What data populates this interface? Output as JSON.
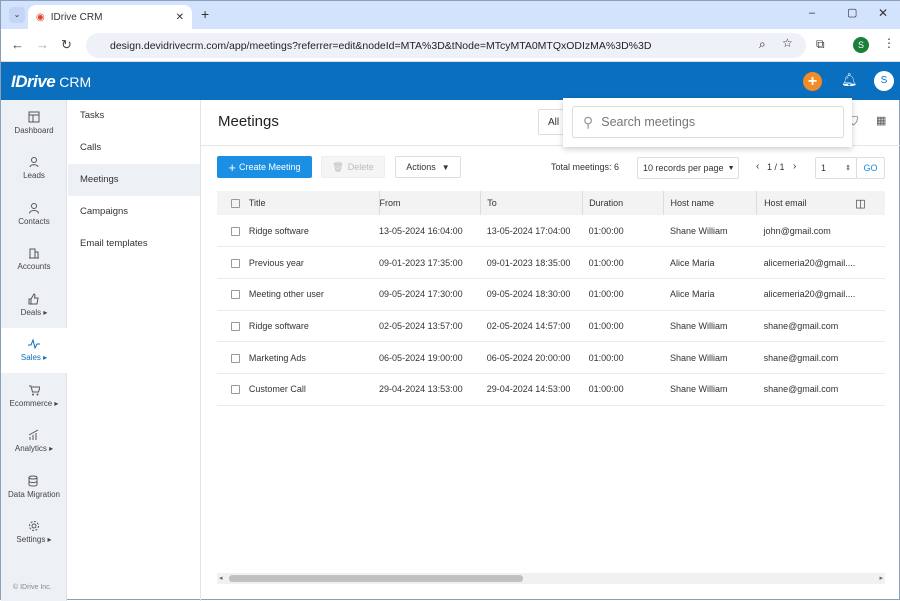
{
  "browser": {
    "tab_title": "IDrive CRM",
    "url": "design.devidrivecrm.com/app/meetings?referrer=edit&nodeId=MTA%3D&tNode=MTcyMTA0MTQxODIzMA%3D%3D",
    "profile_initial": "S"
  },
  "app": {
    "logo": "IDrive",
    "logo_suffix": "CRM",
    "user_initial": "S",
    "accent": "#0a6fbe",
    "add_color": "#f28c28"
  },
  "rail": {
    "items": [
      {
        "label": "Dashboard"
      },
      {
        "label": "Leads"
      },
      {
        "label": "Contacts"
      },
      {
        "label": "Accounts"
      },
      {
        "label": "Deals ▸"
      },
      {
        "label": "Sales ▸"
      },
      {
        "label": "Ecommerce ▸"
      },
      {
        "label": "Analytics ▸"
      },
      {
        "label": "Data Migration"
      },
      {
        "label": "Settings ▸"
      }
    ],
    "copyright": "© IDrive Inc."
  },
  "submenu": {
    "items": [
      "Tasks",
      "Calls",
      "Meetings",
      "Campaigns",
      "Email templates"
    ]
  },
  "main": {
    "title": "Meetings",
    "filter_select": "All",
    "search_placeholder": "Search meetings",
    "create_label": "Create Meeting",
    "delete_label": "Delete",
    "actions_label": "Actions",
    "total_label": "Total meetings: 6",
    "per_page": "10 records per page",
    "page_info": "1 / 1",
    "page_input": "1",
    "go_label": "GO"
  },
  "table": {
    "columns": [
      "Title",
      "From",
      "To",
      "Duration",
      "Host name",
      "Host email"
    ],
    "rows": [
      [
        "Ridge software",
        "13-05-2024 16:04:00",
        "13-05-2024 17:04:00",
        "01:00:00",
        "Shane William",
        "john@gmail.com"
      ],
      [
        "Previous year",
        "09-01-2023 17:35:00",
        "09-01-2023 18:35:00",
        "01:00:00",
        "Alice Maria",
        "alicemeria20@gmail...."
      ],
      [
        "Meeting other user",
        "09-05-2024 17:30:00",
        "09-05-2024 18:30:00",
        "01:00:00",
        "Alice Maria",
        "alicemeria20@gmail...."
      ],
      [
        "Ridge software",
        "02-05-2024 13:57:00",
        "02-05-2024 14:57:00",
        "01:00:00",
        "Shane William",
        "shane@gmail.com"
      ],
      [
        "Marketing Ads",
        "06-05-2024 19:00:00",
        "06-05-2024 20:00:00",
        "01:00:00",
        "Shane William",
        "shane@gmail.com"
      ],
      [
        "Customer Call",
        "29-04-2024 13:53:00",
        "29-04-2024 14:53:00",
        "01:00:00",
        "Shane William",
        "shane@gmail.com"
      ]
    ]
  }
}
